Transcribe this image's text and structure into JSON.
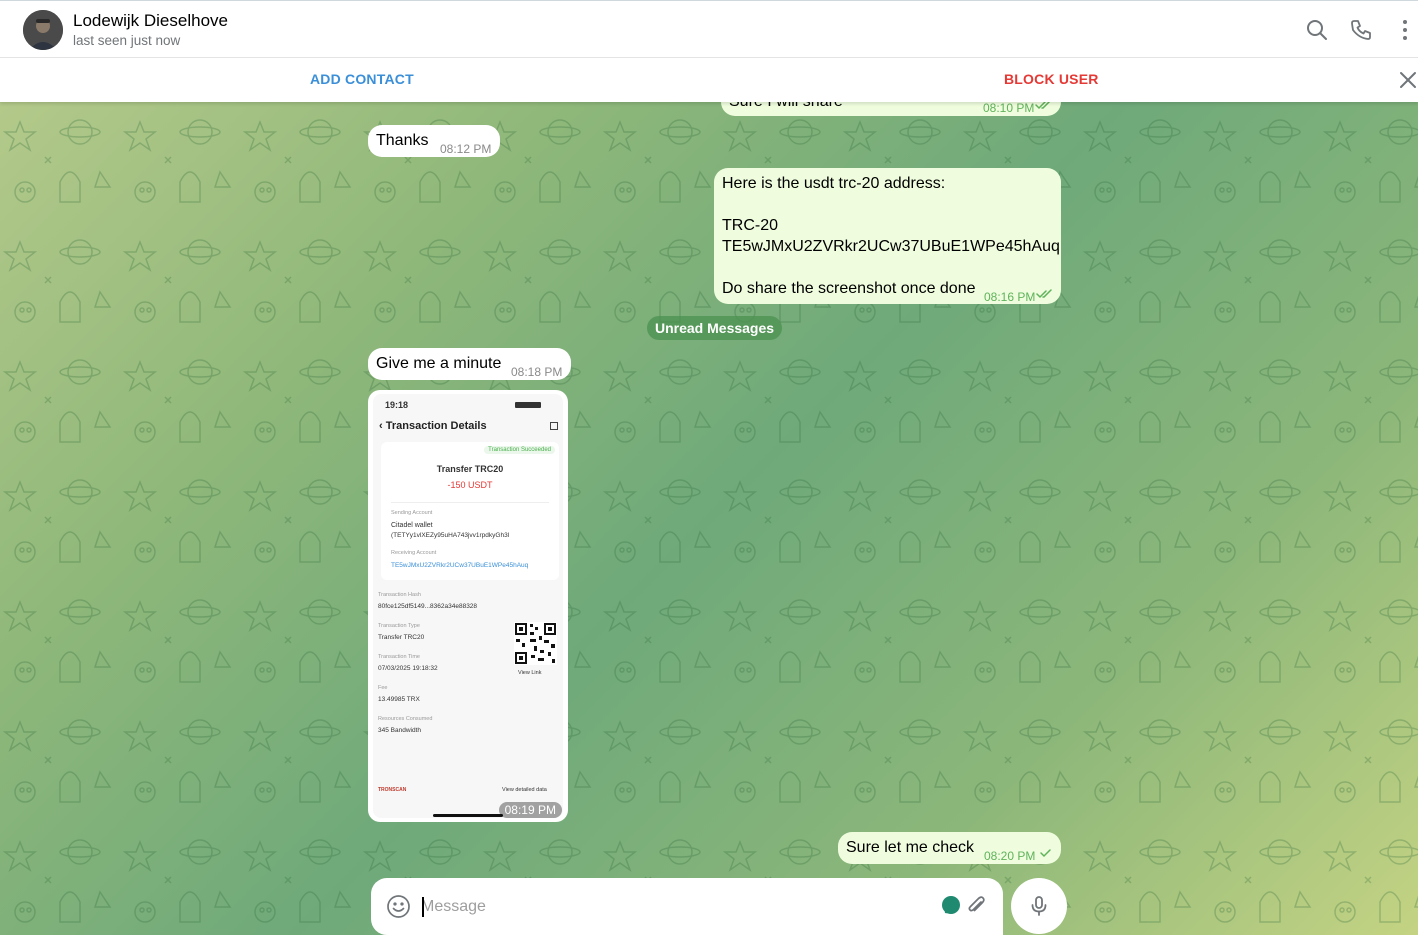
{
  "header": {
    "name": "Lodewijk Dieselhove",
    "status": "last seen just now"
  },
  "action_bar": {
    "add_contact": "ADD CONTACT",
    "block_user": "BLOCK USER"
  },
  "messages": [
    {
      "direction": "out",
      "text": "Sure I will share",
      "time": "08:10 PM",
      "ticks": "double"
    },
    {
      "direction": "in",
      "text": "Thanks",
      "time": "08:12 PM"
    },
    {
      "direction": "out",
      "lines": [
        "Here is the usdt trc-20 address:",
        "",
        "TRC-20",
        "TE5wJMxU2ZVRkr2UCw37UBuE1WPe45hAuq",
        "",
        "Do share the screenshot once done"
      ],
      "time": "08:16 PM",
      "ticks": "double"
    },
    {
      "direction": "in",
      "text": "Give me a minute",
      "time": "08:18 PM"
    },
    {
      "direction": "in",
      "type": "photo",
      "time": "08:19 PM"
    },
    {
      "direction": "out",
      "text": "Sure let me check",
      "time": "08:20 PM",
      "ticks": "single"
    }
  ],
  "divider": {
    "unread": "Unread Messages"
  },
  "screenshot": {
    "status_time": "19:18",
    "title": "Transaction Details",
    "badge": "Transaction Succeeded",
    "transfer_label": "Transfer TRC20",
    "amount": "-150 USDT",
    "sending_account_label": "Sending Account",
    "sending_wallet": "Citadel wallet",
    "sending_address": "(TETYy1vlXEZy95uHA743jvv1rpdkyGh3l",
    "receiving_account_label": "Receiving Account",
    "receiving_address": "TE5wJMxU2ZVRkr2UCw37UBuE1WPe45hAuq",
    "tx_hash_label": "Transaction Hash",
    "tx_hash": "80fce125df5149...8362a34e88328",
    "tx_type_label": "Transaction Type",
    "tx_type": "Transfer TRC20",
    "tx_time_label": "Transaction Time",
    "tx_time": "07/03/2025 19:18:32",
    "fee_label": "Fee",
    "fee": "13.49985 TRX",
    "resources_label": "Resources Consumed",
    "resources": "345 Bandwidth",
    "view_link": "View Link",
    "brand": "TRONSCAN",
    "view_details": "View detailed data"
  },
  "composer": {
    "placeholder": "Message"
  },
  "colors": {
    "accent_blue": "#3a8fd8",
    "danger_red": "#e53935",
    "outgoing_bubble": "#effdde",
    "tick_green": "#5fb35a"
  },
  "icons": [
    "search-icon",
    "phone-icon",
    "more-vertical-icon",
    "close-icon",
    "emoji-icon",
    "sticker-icon",
    "paperclip-icon",
    "microphone-icon",
    "double-check-icon",
    "check-icon"
  ]
}
